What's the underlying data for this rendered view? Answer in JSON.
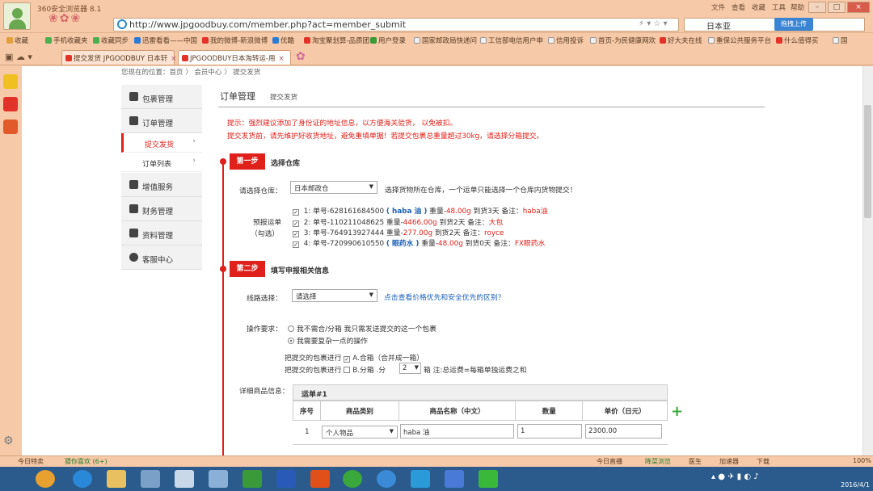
{
  "browser": {
    "title": "360安全浏览器 8.1",
    "menu": [
      "文件",
      "查看",
      "收藏",
      "工具",
      "帮助"
    ],
    "url": "http://www.jpgoodbuy.com/member.php?act=member_submit",
    "search_placeholder": "日本亚",
    "search_button": "拖拽上传",
    "bookmarks": [
      "收藏",
      "手机收藏夹",
      "收藏同步",
      "迅雷看看——中国",
      "我的微博-新浪微博",
      "优酷",
      "淘宝聚划算-品质团",
      "用户登录",
      "国家邮政局快递问",
      "工信部电信用户申",
      "信用投诉",
      "首页-为民健康网欢",
      "好大夫在线",
      "重保公共服务平台",
      "什么值得买",
      "国"
    ],
    "tabs": [
      "提交发货 JPGOODBUY 日本轩",
      "JPGOODBUY日本淘转运-用"
    ]
  },
  "breadcrumb": "您现在的位置：首页 〉 会员中心 〉 提交发货",
  "left_menu": {
    "items": [
      "包裹管理",
      "订单管理",
      "增值服务",
      "财务管理",
      "资料管理",
      "客服中心"
    ],
    "sub_items": [
      "提交发货",
      "订单列表"
    ]
  },
  "header": {
    "title": "订单管理",
    "subtitle": "提交发货"
  },
  "notices": [
    "提示：强烈建议添加了身份证的地址信息，以方便海关验货， 以免被扣。",
    "提交发货前，请先维护好收货地址，避免重填单据！若提交包裹总重量超过30kg，请选择分箱提交。"
  ],
  "step1": {
    "badge": "第一步",
    "title": "选择仓库",
    "warehouse_label": "请选择仓库：",
    "warehouse_value": "日本邮政仓",
    "warehouse_hint": "选择货物所在仓库，一个运单只能选择一个仓库内货物提交！",
    "prereport_label": "预报运单",
    "prereport_sub": "（勾选）",
    "parcels": [
      {
        "idx": "1:",
        "no": "单号-628161684500",
        "name": "( haba 油 )",
        "w_label": "重量-",
        "weight": "48.00g",
        "days": "到货3天",
        "note_label": "备注：",
        "note": "haba油"
      },
      {
        "idx": "2:",
        "no": "单号-110211048625",
        "name": "",
        "w_label": "重量-",
        "weight": "4466.00g",
        "days": "到货2天",
        "note_label": "备注：",
        "note": "大包"
      },
      {
        "idx": "3:",
        "no": "单号-764913927444",
        "name": "",
        "w_label": "重量-",
        "weight": "277.00g",
        "days": "到货2天",
        "note_label": "备注：",
        "note": "royce"
      },
      {
        "idx": "4:",
        "no": "单号-720990610550",
        "name": "( 眼药水 )",
        "w_label": "重量-",
        "weight": "48.00g",
        "days": "到货0天",
        "note_label": "备注：",
        "note": "FX眼药水"
      }
    ]
  },
  "step2": {
    "badge": "第二步",
    "title": "填写申报相关信息",
    "route_label": "线路选择：",
    "route_value": "请选择",
    "route_link": "点击查看价格优先和安全优先的区别？",
    "op_label": "操作要求：",
    "op_option1": "我不需合/分箱 我只需发送提交的这一个包裹",
    "op_option2": "我需要复杂一点的操作",
    "merge_prefix": "把提交的包裹进行",
    "merge_option": "A.合箱（合并成一箱）",
    "split_prefix": "把提交的包裹进行",
    "split_option": "B.分箱 .分",
    "split_count": "2",
    "split_note": "箱 注:总运费=每箱单独运费之和",
    "detail_label": "详细商品信息：",
    "waybill": "运单#1",
    "columns": [
      "序号",
      "商品类别",
      "商品名称（中文）",
      "数量",
      "单价（日元）"
    ],
    "rows": [
      {
        "no": "1",
        "category": "个人物品",
        "name": "haba 油",
        "qty": "1",
        "price": "2300.00"
      }
    ]
  },
  "statusbar": {
    "left": "今日特卖",
    "center": "猜你喜欢 (6+)",
    "right1": "今日直播",
    "right2": "降菜浏览",
    "right3": "医生",
    "right4": "加速器",
    "right5": "下载",
    "zoom": "100%"
  },
  "taskbar": {
    "date": "2016/4/1"
  }
}
